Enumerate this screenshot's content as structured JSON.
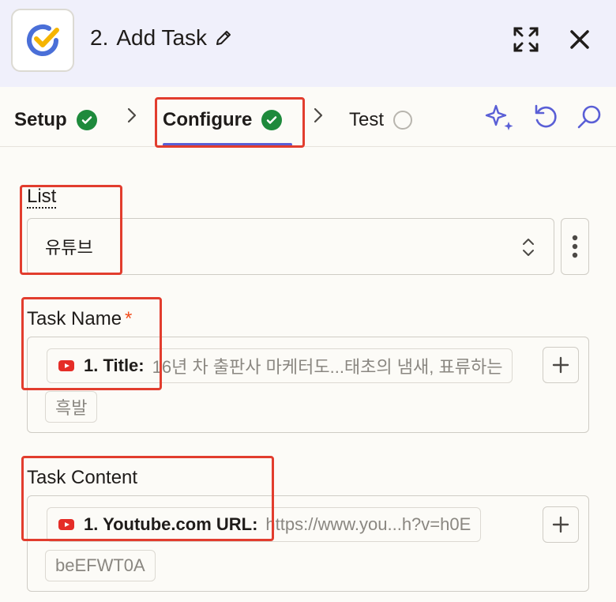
{
  "header": {
    "step_number": "2.",
    "step_name": "Add Task",
    "icons": {
      "app_logo": "ticktick-logo-icon",
      "edit": "pencil-icon",
      "expand": "expand-icon",
      "close": "close-icon"
    }
  },
  "tabs": [
    {
      "label": "Setup",
      "status": "complete"
    },
    {
      "label": "Configure",
      "status": "complete",
      "active": true
    },
    {
      "label": "Test",
      "status": "pending"
    }
  ],
  "toolbar_icons": [
    "sparkle-icon",
    "refresh-icon",
    "search-icon"
  ],
  "fields": {
    "list": {
      "label": "List",
      "value": "유튜브"
    },
    "task_name": {
      "label": "Task Name",
      "required_marker": "*",
      "token_key": "1. Title:",
      "token_value": "16년 차 출판사 마케터도...태초의 냄새, 표류하는",
      "continuation": "흑발"
    },
    "task_content": {
      "label": "Task Content",
      "token_key": "1. Youtube.com URL:",
      "token_value": "https://www.you...h?v=h0E",
      "continuation": "beEFWT0A"
    }
  },
  "colors": {
    "accent": "#5a5fd6",
    "success": "#1e8a3c",
    "highlight": "#e23d2e",
    "youtube": "#e52d27",
    "required": "#f24e1e"
  }
}
